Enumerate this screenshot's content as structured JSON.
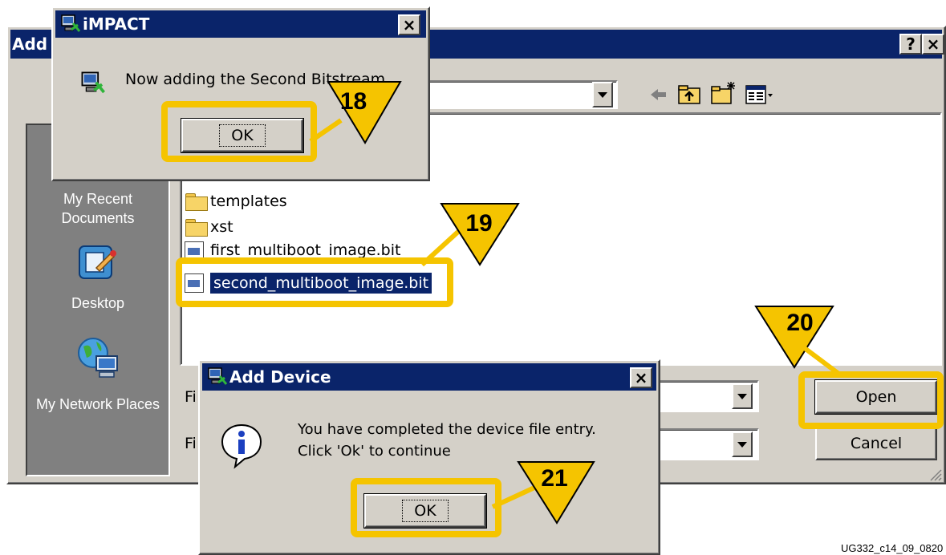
{
  "add_file_dialog": {
    "title_partial": "Add",
    "help_button": "?",
    "close_button": "×",
    "places": [
      {
        "label": "My Recent Documents",
        "icon": "recent-documents-icon"
      },
      {
        "label": "Desktop",
        "icon": "desktop-icon"
      },
      {
        "label": "My Network Places",
        "icon": "network-places-icon"
      }
    ],
    "toolbar_icons": [
      "back-arrow-icon",
      "up-folder-icon",
      "new-folder-icon",
      "view-menu-icon"
    ],
    "files": [
      {
        "name": "templates",
        "type": "folder"
      },
      {
        "name": "xst",
        "type": "folder"
      },
      {
        "name": "first_multiboot_image.bit",
        "type": "bit"
      },
      {
        "name": "second_multiboot_image.bit",
        "type": "bit",
        "selected": true
      }
    ],
    "file_name_label_partial": "Fi",
    "file_type_label_partial": "Fi",
    "open_button": "Open",
    "cancel_button": "Cancel"
  },
  "impact_dialog": {
    "title": "iMPACT",
    "close_button": "×",
    "message": "Now adding the Second Bitstream",
    "ok_button": "OK"
  },
  "add_device_dialog": {
    "title": "Add Device",
    "close_button": "×",
    "message_line1": "You have completed the device file entry.",
    "message_line2": "Click 'Ok' to continue",
    "ok_button": "OK"
  },
  "callouts": {
    "c18": "18",
    "c19": "19",
    "c20": "20",
    "c21": "21"
  },
  "highlight_color": "#f5c400",
  "figure_id": "UG332_c14_09_0820"
}
